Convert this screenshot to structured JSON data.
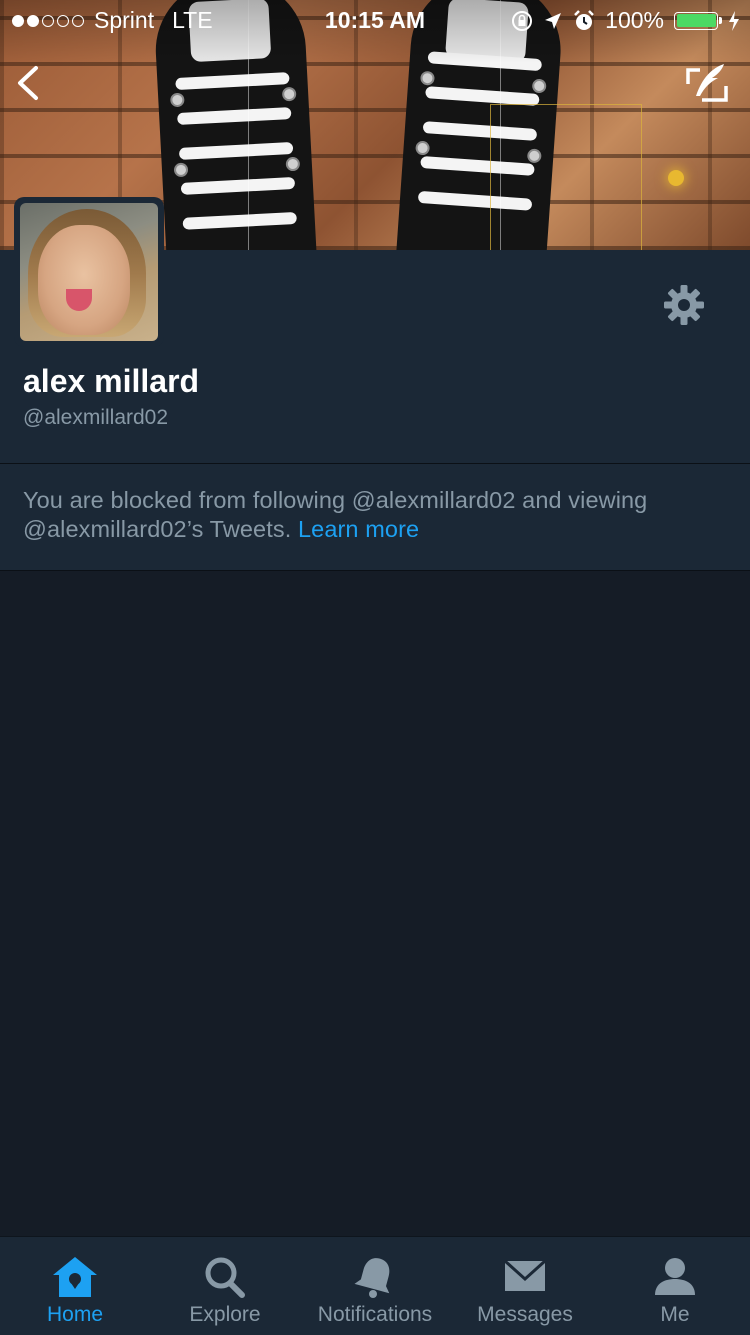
{
  "status_bar": {
    "carrier": "Sprint",
    "network": "LTE",
    "time": "10:15 AM",
    "battery_percent": "100%",
    "signal_bars_filled": 2,
    "signal_bars_total": 5
  },
  "profile": {
    "name": "alex millard",
    "handle": "@alexmillard02"
  },
  "blocked_notice": {
    "text": "You are blocked from following @alexmillard02 and viewing @alexmillard02’s Tweets.",
    "link_label": "Learn more"
  },
  "tabs": [
    {
      "label": "Home",
      "icon": "home-icon",
      "active": true
    },
    {
      "label": "Explore",
      "icon": "search-icon",
      "active": false
    },
    {
      "label": "Notifications",
      "icon": "bell-icon",
      "active": false
    },
    {
      "label": "Messages",
      "icon": "envelope-icon",
      "active": false
    },
    {
      "label": "Me",
      "icon": "person-icon",
      "active": false
    }
  ],
  "colors": {
    "background": "#151c26",
    "panel": "#1b2836",
    "accent": "#1da1f2",
    "muted_text": "#8899a6",
    "battery_green": "#4cd964"
  }
}
